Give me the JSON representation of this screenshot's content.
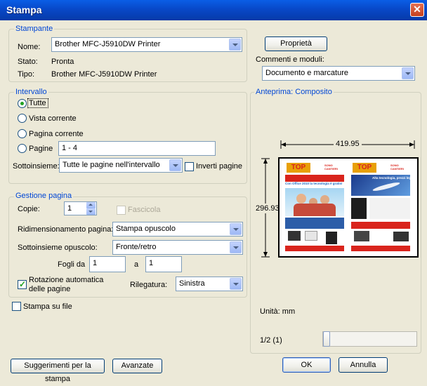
{
  "window": {
    "title": "Stampa"
  },
  "printer": {
    "group_label": "Stampante",
    "name_label": "Nome:",
    "name_value": "Brother MFC-J5910DW Printer",
    "status_label": "Stato:",
    "status_value": "Pronta",
    "type_label": "Tipo:",
    "type_value": "Brother MFC-J5910DW Printer",
    "properties_button": "Proprietà",
    "comments_label": "Commenti e moduli:",
    "comments_value": "Documento e marcature"
  },
  "range": {
    "group_label": "Intervallo",
    "options": [
      "Tutte",
      "Vista corrente",
      "Pagina corrente",
      "Pagine"
    ],
    "selected": "Tutte",
    "pages_value": "1 - 4",
    "subset_label": "Sottoinsieme:",
    "subset_value": "Tutte le pagine nell'intervallo",
    "reverse_label": "Inverti pagine"
  },
  "page_handling": {
    "group_label": "Gestione pagina",
    "copies_label": "Copie:",
    "copies_value": "1",
    "collate_label": "Fascicola",
    "scaling_label": "Ridimensionamento pagina:",
    "scaling_value": "Stampa opuscolo",
    "booklet_subset_label": "Sottoinsieme opuscolo:",
    "booklet_subset_value": "Fronte/retro",
    "sheets_label": "Fogli da",
    "sheets_from": "1",
    "sheets_to_label": "a",
    "sheets_to": "1",
    "auto_rotate_label_1": "Rotazione automatica",
    "auto_rotate_label_2": "delle pagine",
    "auto_rotate_checked": true,
    "binding_label": "Rilegatura:",
    "binding_value": "Sinistra"
  },
  "print_to_file_label": "Stampa su file",
  "preview": {
    "group_label": "Anteprima: Composito",
    "width_dim": "419.95",
    "height_dim": "296.93",
    "units_label": "Unità: mm",
    "page_indicator": "1/2 (1)",
    "slider_position": 0,
    "left_page": {
      "logo": "TOP",
      "header_text": "Con Office 2010 la tecnologia è gratis!",
      "badge": "SONO CANTIERI"
    },
    "right_page": {
      "logo": "TOP",
      "header_text": "Alta tecnologia, prezzi leggeri",
      "badge": "SONO CANTIERI"
    }
  },
  "buttons": {
    "tips": "Suggerimenti per la stampa",
    "advanced": "Avanzate",
    "ok": "OK",
    "cancel": "Annulla"
  },
  "colors": {
    "titlebar": "#0a5ee6",
    "accent_red": "#d9241c",
    "group_text": "#0046d5"
  }
}
